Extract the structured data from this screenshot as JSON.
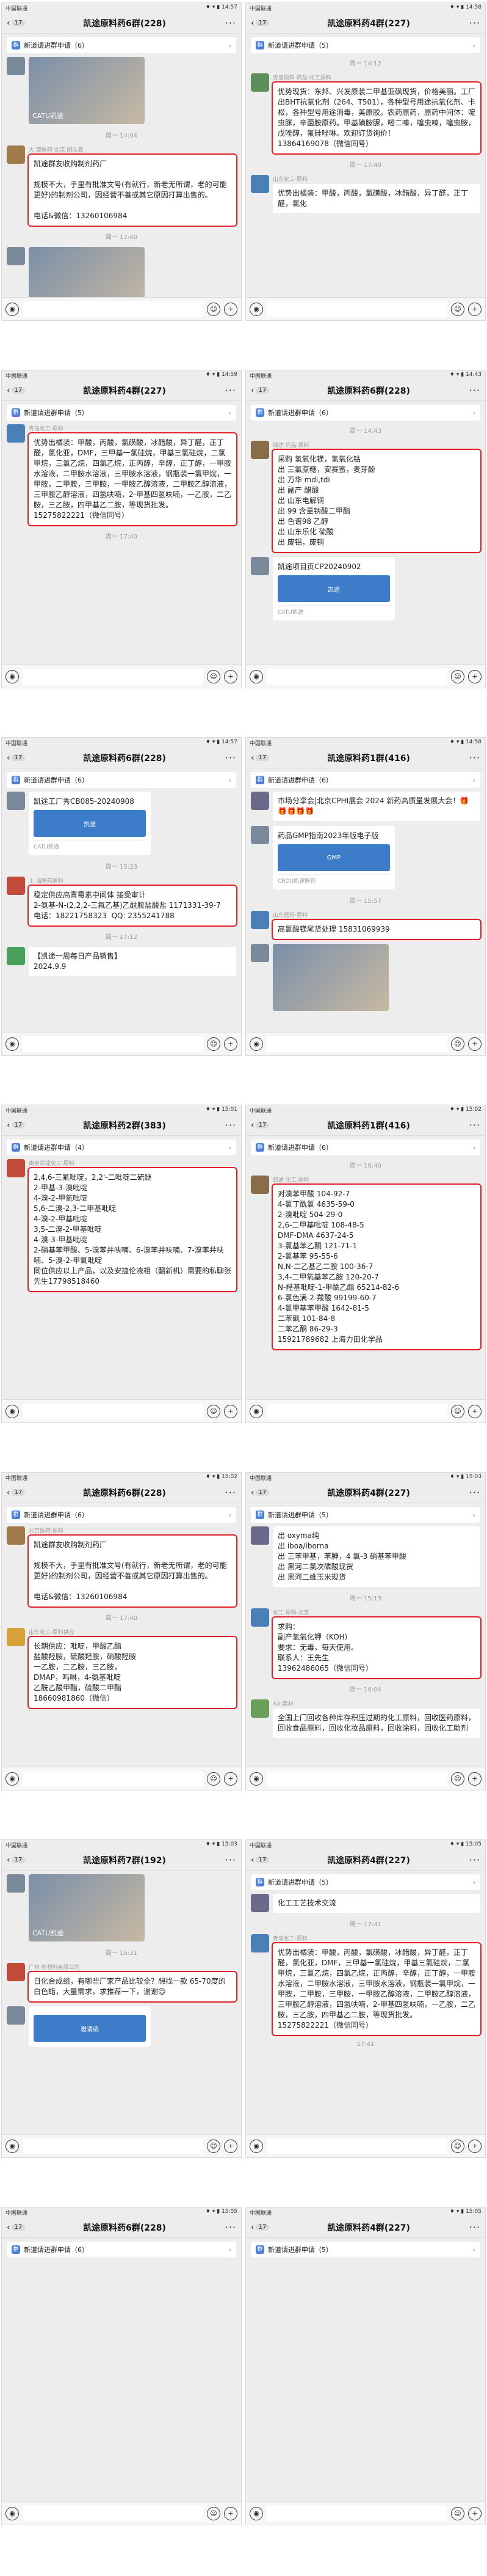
{
  "status": {
    "carrier": "中国联通",
    "icons": "♦ ▾ ▮"
  },
  "common": {
    "more": "···",
    "back_arrow": "‹",
    "chevron": "›",
    "plus": "+",
    "emoji": "☺",
    "voice": "◉"
  },
  "panels": [
    {
      "back_count": "17",
      "title": "凯途原料药6群(228)",
      "notice": "新道请进群申请（6）",
      "time_status": "14:57",
      "messages": [
        {
          "type": "image",
          "label": "CATU凯途"
        },
        {
          "type": "time",
          "text": "周一 14:04"
        },
        {
          "type": "text",
          "sender": "大 康医药·北京·团队鑫",
          "avatar": "#a07a4a",
          "hl": true,
          "text": "凯途群友收购制剂药厂\n\n规模不大，手里有批准文号(有就行，新老无所谓，老的可能更好)的制剂公司，因经营不善或其它原因打算出售的。\n\n电话&微信：13260106984"
        },
        {
          "type": "time",
          "text": "周一 17:40"
        },
        {
          "type": "image",
          "label": ""
        }
      ]
    },
    {
      "back_count": "17",
      "title": "凯途原料药4群(227)",
      "notice": "新道请进群申请（5）",
      "time_status": "14:58",
      "messages": [
        {
          "type": "time",
          "text": "周一 14:12"
        },
        {
          "type": "text",
          "sender": "青岛原料 药品·化工原料",
          "avatar": "#5c8f5a",
          "hl": true,
          "text": "优势现货：东邦、兴发原装二甲基亚砜现货，价格美丽。工厂出BHT抗氧化剂（264、T501），各种型号用途抗氧化剂、卡松，各种型号用途消毒，美原胶。农药原药，原药中间体：啶虫脒，辛菌胺原药。甲基磺胺脲，嘧二嗪，噻虫嗪，噻虫胺，戊唑醇，氟硅唑啉。欢迎订货询价！\n13864169078（微信同号）"
        },
        {
          "type": "time",
          "text": "周一 17:40"
        },
        {
          "type": "text",
          "sender": "山东化工·原料",
          "avatar": "#4a7fb8",
          "hl": false,
          "text": "优势出橘装：甲酸，丙酸，氯磺酸，冰醋酸，异丁醛，正丁醛，氯化"
        }
      ]
    },
    {
      "back_count": "17",
      "title": "凯途原料药4群(227)",
      "notice": "新道请进群申请（5）",
      "time_status": "14:59",
      "messages": [
        {
          "type": "text",
          "sender": "青岛化工·原料",
          "avatar": "#4a7fb8",
          "hl": true,
          "text": "优势出橘装：甲酸，丙酸，氯磺酸，冰醋酸，异丁醛，正丁醛，氯化亚，DMF，三甲基一氯硅烷，甲基三氯硅烷，二氯甲烷，三氯乙烷，四氯乙烷，正丙醇，辛醇，正丁醇，一甲胺水溶液，二甲胺水溶液，三甲胺水溶液，钢瓶装一氯甲烷，一甲胺，二甲胺，三甲胺，一甲胺乙醇溶液，二甲胺乙醇溶液，三甲胺乙醇溶液，四氢呋喃，2-甲基四氢呋喃，一乙胺，二乙胺，三乙胺，四甲基乙二胺，等现货批发。\n15275822221（微信同号）"
        },
        {
          "type": "time",
          "text": "周一 17:40"
        }
      ]
    },
    {
      "back_count": "17",
      "title": "凯途原料药6群(228)",
      "notice": "新道请进群申请（6）",
      "time_status": "14:43",
      "messages": [
        {
          "type": "time",
          "text": "周一 14:43"
        },
        {
          "type": "text",
          "sender": "瑞达 药品·原料",
          "avatar": "#8a6b4a",
          "hl": true,
          "text": "采购 氢氧化镁，氢氧化钴\n出 三氯蔗糖，安赛蜜，麦芽酚\n出 万华 mdi,tdi\n出 副产 醋酸\n出 山东电解铜\n出 99 含量钠酸二甲酯\n出 色谱98 乙醇\n出 山东乐化 硫酸\n出 废铝，废铜"
        },
        {
          "type": "card",
          "title": "凯途项目页CP20240902",
          "img": "凯途",
          "foot": "CATU凯途"
        }
      ]
    },
    {
      "back_count": "17",
      "title": "凯途原料药6群(228)",
      "notice": "新道请进群申请（6）",
      "time_status": "14:57",
      "messages": [
        {
          "type": "card",
          "title": "凯途工厂秀CB085-20240908",
          "img": "凯途",
          "foot": "CATU凯途"
        },
        {
          "type": "time",
          "text": "周一 15:33"
        },
        {
          "type": "text",
          "sender": "上 海医药原料",
          "avatar": "#c24a3a",
          "hl": true,
          "text": "稳定供应高青霉素中间体 接受审计\n2-氨基-N-(2,2,2-三氟乙基)乙酰胺盐酸盐 1171331-39-7\n电话：18221758323  QQ: 2355241788"
        },
        {
          "type": "time",
          "text": "周一 17:12"
        },
        {
          "type": "text",
          "sender": "",
          "avatar": "#4aa05a",
          "hl": false,
          "text": "【凯途一周每日产品销售】\n2024.9.9"
        }
      ]
    },
    {
      "back_count": "17",
      "title": "凯途原料药1群(416)",
      "notice": "新道请进群申请（6）",
      "time_status": "14:58",
      "messages": [
        {
          "type": "text",
          "sender": "",
          "avatar": "#6a6a8a",
          "hl": false,
          "text": "市场分享会|北京CPHI展会 2024 新药高质量发展大会！🎁🎁🎁🎁🎁"
        },
        {
          "type": "card",
          "title": "药品GMP指南2023年版电子版",
          "img": "GMP",
          "foot": "CROU凯途医药"
        },
        {
          "type": "time",
          "text": "周一 15:57"
        },
        {
          "type": "text",
          "sender": "山东医药·原料",
          "avatar": "#4a7fb8",
          "hl": true,
          "text": "高氯酸镁尾货处理 15831069939"
        },
        {
          "type": "image",
          "label": ""
        }
      ]
    },
    {
      "back_count": "17",
      "title": "凯途原料药2群(383)",
      "notice": "新道请进群申请（4）",
      "time_status": "15:01",
      "messages": [
        {
          "type": "text",
          "sender": "南京凯途化工·原料",
          "avatar": "#c24a3a",
          "hl": true,
          "text": "2,4,6-三氟吡啶，2,2'-二吡啶二硫醚\n2-甲基-3-溴吡啶\n4-溴-2-甲氧吡啶\n5,6-二溴-2,3-二甲基吡啶\n4-溴-2-甲基吡啶\n3,5-二溴-2-甲基吡啶\n4-溴-3-甲基吡啶\n2-硝基苯甲酸、5-溴苯并呋喃、6-溴苯并呋喃、7-溴苯并呋喃、5-溴-2-甲氧吡啶\n同位供应以上产品，以及安捷伦液相（翻新机）需要的私聊张先生17798518460"
        }
      ]
    },
    {
      "back_count": "17",
      "title": "凯途原料药1群(416)",
      "notice": "新道请进群申请（6）",
      "time_status": "15:02",
      "messages": [
        {
          "type": "time",
          "text": "周一 16:40"
        },
        {
          "type": "text",
          "sender": "凯途 化工·原料",
          "avatar": "#8a6b4a",
          "hl": true,
          "text": "对溴苯甲酸 104-92-7\n4-氯丁酰氯 4635-59-0\n2-溴吡啶 504-29-0\n2,6-二甲基吡啶 108-48-5\nDMF-DMA 4637-24-5\n3-氯基苯乙酮 121-71-1\n2-氯基苯 95-55-6\nN,N-二乙基乙二胺 100-36-7\n3,4-二甲氧基苯乙胺 120-20-7\nN-羟基吡啶-1-甲酰乙酯 65214-82-6\n6-氯色满-2-羧酸 99199-60-7\n4-氯甲基苯甲酸 1642-81-5\n二苯砜 101-84-8\n二苯乙酮 86-29-3\n15921789682 上海力田化学品"
        }
      ]
    },
    {
      "back_count": "17",
      "title": "凯途原料药6群(228)",
      "notice": "新道请进群申请（6）",
      "time_status": "15:02",
      "messages": [
        {
          "type": "text",
          "sender": "北京医药·原料",
          "avatar": "#a07a4a",
          "hl": true,
          "text": "凯途群友收购制剂药厂\n\n规模不大，手里有批准文号(有就行，新老无所谓，老的可能更好)的制剂公司，因经营不善或其它原因打算出售的。\n\n电话&微信：13260106984"
        },
        {
          "type": "time",
          "text": "周一 17:40"
        },
        {
          "type": "text",
          "sender": "山东化工·原料供应",
          "avatar": "#d8a23a",
          "hl": true,
          "text": "长期供应：吡啶，甲酸乙酯\n盐酸羟胺，硫酸羟胺，硝酸羟胺\n一乙胺，二乙胺，三乙胺，\nDMAP，吗啉，4-氨基吡啶\n乙酰乙酸甲酯，硫酸二甲酯\n18660981860（微信）"
        }
      ]
    },
    {
      "back_count": "17",
      "title": "凯途原料药4群(227)",
      "notice": "新道请进群申请（5）",
      "time_status": "15:03",
      "messages": [
        {
          "type": "text",
          "sender": "",
          "avatar": "#6a6a8a",
          "hl": false,
          "text": "出 oxyma纯\n出 iboa/iborna\n出 三苯甲基，苯胂，4 氯-3 硝基苯甲酸\n出 黑河二氯次磷酸现货\n出 黑河二维玉米现货"
        },
        {
          "type": "time",
          "text": "周一 15:13"
        },
        {
          "type": "text",
          "sender": "化工 原料·北京",
          "avatar": "#4a7fb8",
          "hl": true,
          "text": "求购：\n副产氢氧化钾（KOH）\n要求：无毒，每天使用。\n联系人：王先生\n13962486065（微信同号）"
        },
        {
          "type": "time",
          "text": "周一 16:04"
        },
        {
          "type": "text",
          "sender": "AA-建材",
          "avatar": "#6aa05a",
          "hl": false,
          "text": "全国上门回收各种库存积压过期的化工原料，回收医药原料，回收食品原料，回收化妆品原料，回收涂料，回收化工助剂"
        }
      ]
    },
    {
      "back_count": "17",
      "title": "凯途原料药7群(192)",
      "notice": "",
      "time_status": "15:03",
      "messages": [
        {
          "type": "image",
          "label": "CATU凯途"
        },
        {
          "type": "time",
          "text": "周一 16:31"
        },
        {
          "type": "text",
          "sender": "广州 新材料有限公司",
          "avatar": "#c24a3a",
          "hl": true,
          "text": "日化合成组，有哪些厂家产品比较全？想找一款 65-70度的白色蜡，大量需求，求推荐一下，谢谢😊"
        },
        {
          "type": "card",
          "title": "",
          "img": "邀请函",
          "foot": ""
        }
      ]
    },
    {
      "back_count": "17",
      "title": "凯途原料药4群(227)",
      "notice": "新道请进群申请（5）",
      "time_status": "15:05",
      "messages": [
        {
          "type": "text",
          "sender": "",
          "avatar": "#6a6a8a",
          "hl": false,
          "text": "化工工艺技术交流"
        },
        {
          "type": "time",
          "text": "周一 17:41"
        },
        {
          "type": "text",
          "sender": "青岛化工·原料",
          "avatar": "#4a7fb8",
          "hl": true,
          "text": "优势出橘装：甲酸，丙酸，氯磺酸，冰醋酸，异丁醛，正丁醛，氯化亚，DMF，三甲基一氯硅烷，甲基三氯硅烷，二氯甲烷，三氯乙烷，四氯乙烷，正丙醇，辛醇，正丁醇，一甲胺水溶液，二甲胺水溶液，三甲胺水溶液，钢瓶装一氯甲烷，一甲胺，二甲胺，三甲胺，一甲胺乙醇溶液，二甲胺乙醇溶液，三甲胺乙醇溶液，四氢呋喃，2-甲基四氢呋喃，一乙胺，二乙胺，三乙胺，四甲基乙二胺，等现货批发。\n15275822221（微信同号）"
        },
        {
          "type": "time",
          "text": "17:41"
        }
      ]
    },
    {
      "back_count": "17",
      "title": "凯途原料药6群(228)",
      "notice": "新道请进群申请（6）",
      "time_status": "15:05",
      "messages": []
    },
    {
      "back_count": "17",
      "title": "凯途原料药4群(227)",
      "notice": "新道请进群申请（5）",
      "time_status": "15:05",
      "messages": []
    }
  ]
}
